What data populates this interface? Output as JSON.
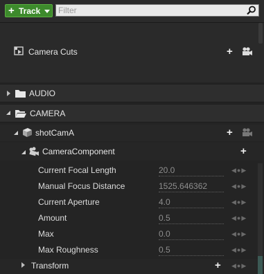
{
  "toolbar": {
    "track_button_label": "Track",
    "filter_placeholder": "Filter"
  },
  "camera_cuts": {
    "label": "Camera Cuts"
  },
  "folders": [
    {
      "label": "AUDIO",
      "expanded": false
    },
    {
      "label": "CAMERA",
      "expanded": true
    }
  ],
  "shot": {
    "label": "shotCamA"
  },
  "component": {
    "label": "CameraComponent"
  },
  "properties": [
    {
      "label": "Current Focal Length",
      "value": "20.0"
    },
    {
      "label": "Manual Focus Distance",
      "value": "1525.646362"
    },
    {
      "label": "Current Aperture",
      "value": "4.0"
    },
    {
      "label": "Amount",
      "value": "0.5"
    },
    {
      "label": "Max",
      "value": "0.0"
    },
    {
      "label": "Max Roughness",
      "value": "0.5"
    }
  ],
  "transform": {
    "label": "Transform"
  },
  "icons": {
    "add": "plus-icon",
    "camera": "camera-icon",
    "folder": "folder-icon",
    "search": "search-icon",
    "keyframe_nav": "keyframe-nav-icons"
  },
  "colors": {
    "track_button": "#3d8a2c",
    "background": "#242424",
    "value_text": "#8e8e8e"
  }
}
